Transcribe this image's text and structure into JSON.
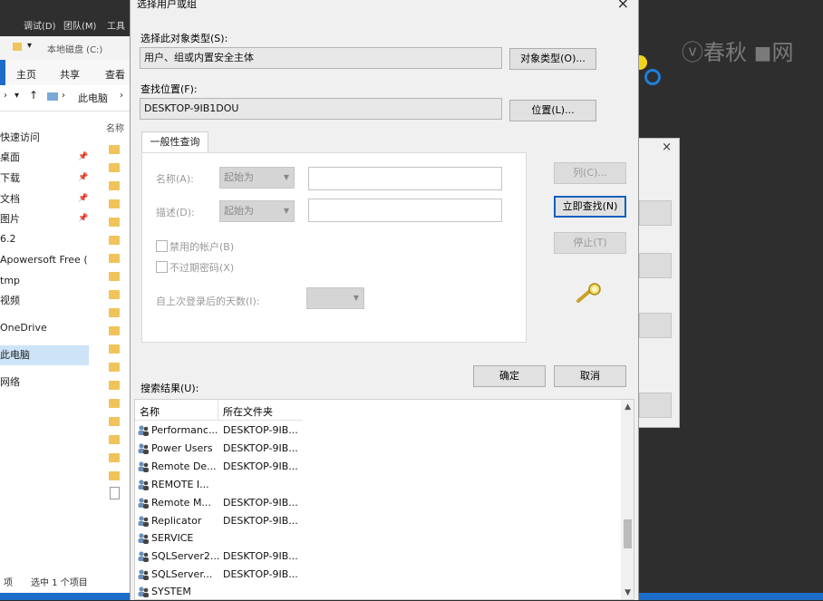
{
  "background": {
    "watermark": "ⓥ春秋 ◼网"
  },
  "explorer": {
    "titlebar": {
      "debug": "调试(D)",
      "team": "团队(M)",
      "tools": "工具"
    },
    "quick_access_path": "本地磁盘 (C:)",
    "ribbon_tabs": [
      "主页",
      "共享",
      "查看"
    ],
    "address_path": "此电脑",
    "column_name": "名称",
    "nav_items": [
      "快速访问",
      "桌面",
      "下载",
      "文档",
      "图片",
      "6.2",
      "Apowersoft Free (",
      "tmp",
      "视频",
      "OneDrive",
      "此电脑",
      "网络"
    ],
    "status_count": "项",
    "status_selected": "选中 1 个项目"
  },
  "dialog": {
    "title": "选择用户或组",
    "close": "×",
    "object_type_label": "选择此对象类型(S):",
    "object_type_value": "用户、组或内置安全主体",
    "object_types_button": "对象类型(O)...",
    "location_label": "查找位置(F):",
    "location_value": "DESKTOP-9IB1DOU",
    "location_button": "位置(L)...",
    "tab_label": "一般性查询",
    "name_label": "名称(A):",
    "name_combo": "起始为",
    "desc_label": "描述(D):",
    "desc_combo": "起始为",
    "disabled_accounts": "禁用的帐户(B)",
    "non_expiring_password": "不过期密码(X)",
    "days_since_logon": "自上次登录后的天数(I):",
    "columns_button": "列(C)...",
    "find_now_button": "立即查找(N)",
    "stop_button": "停止(T)",
    "ok_button": "确定",
    "cancel_button": "取消",
    "results_label": "搜索结果(U):",
    "results_headers": {
      "name": "名称",
      "folder": "所在文件夹"
    },
    "results": [
      {
        "name": "Performanc...",
        "folder": "DESKTOP-9IB..."
      },
      {
        "name": "Power Users",
        "folder": "DESKTOP-9IB..."
      },
      {
        "name": "Remote De...",
        "folder": "DESKTOP-9IB..."
      },
      {
        "name": "REMOTE I...",
        "folder": ""
      },
      {
        "name": "Remote M...",
        "folder": "DESKTOP-9IB..."
      },
      {
        "name": "Replicator",
        "folder": "DESKTOP-9IB..."
      },
      {
        "name": "SERVICE",
        "folder": ""
      },
      {
        "name": "SQLServer2...",
        "folder": "DESKTOP-9IB..."
      },
      {
        "name": "SQLServer...",
        "folder": "DESKTOP-9IB..."
      },
      {
        "name": "SYSTEM",
        "folder": ""
      }
    ]
  },
  "background_dialog": {
    "close": "×"
  },
  "colors": {
    "accent": "#1e6cc9",
    "focus_border": "#0f5fbd",
    "cursor_yellow": "#f1d51a",
    "cursor_ring": "#1e7fd8"
  }
}
